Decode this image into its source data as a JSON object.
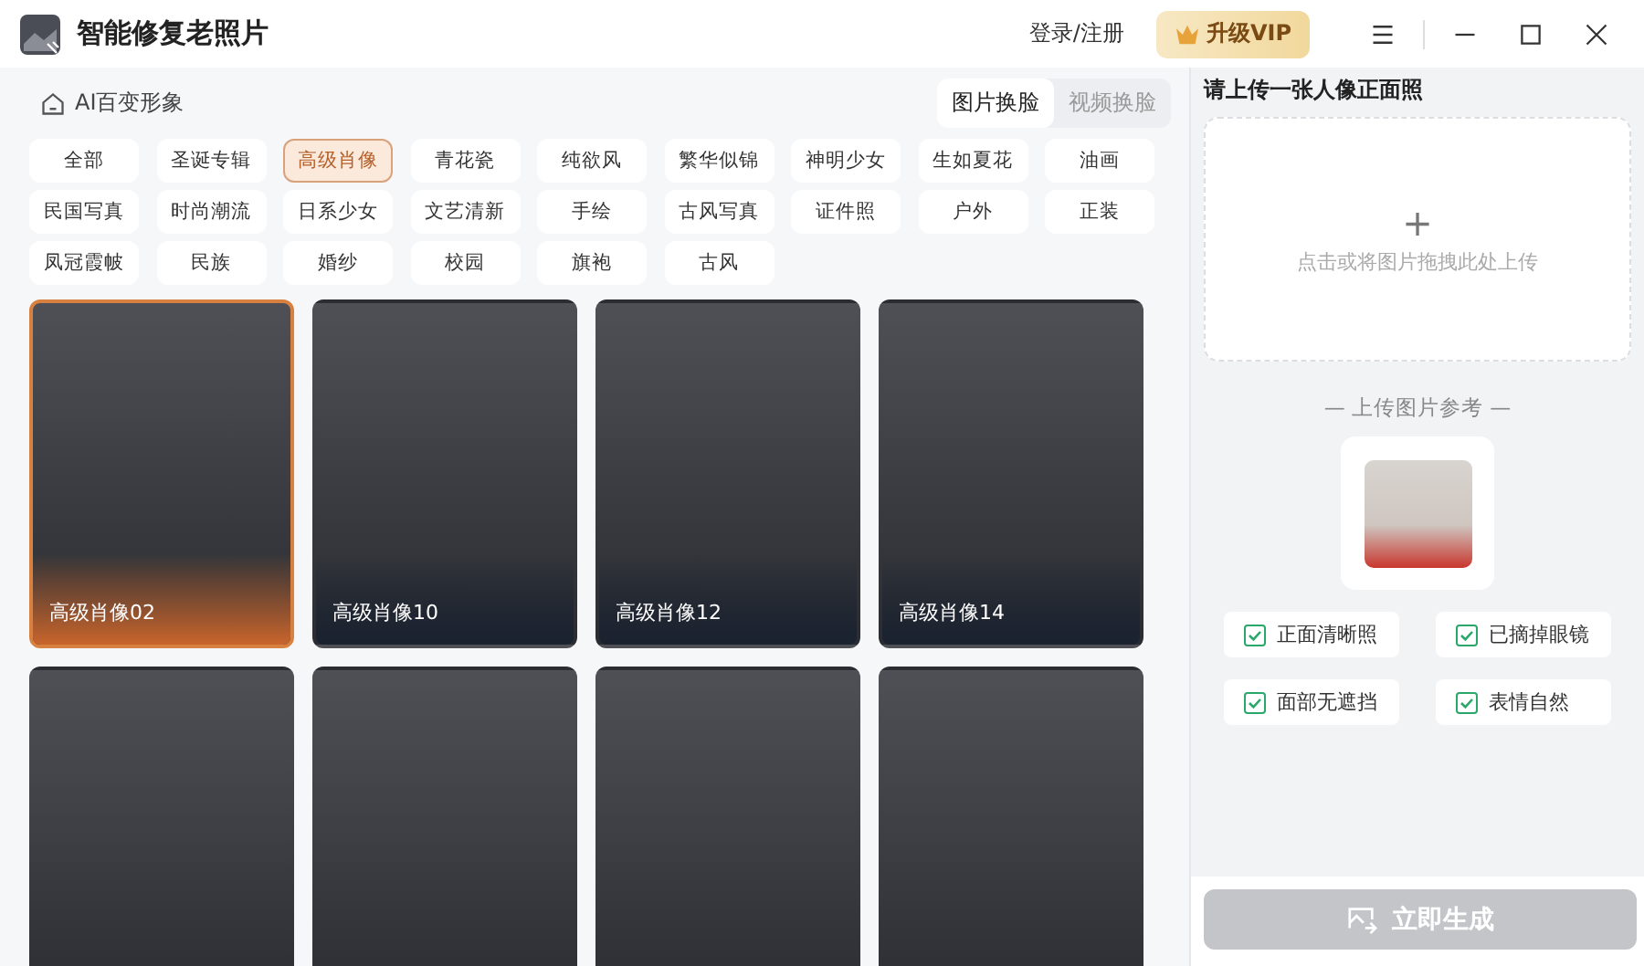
{
  "window": {
    "title": "智能修复老照片",
    "login": "登录/注册",
    "vip": "升级VIP"
  },
  "section": {
    "title": "AI百变形象"
  },
  "modes": [
    {
      "label": "图片换脸",
      "selected": true
    },
    {
      "label": "视频换脸",
      "selected": false
    }
  ],
  "tags": [
    {
      "label": "全部",
      "selected": false
    },
    {
      "label": "圣诞专辑",
      "selected": false
    },
    {
      "label": "高级肖像",
      "selected": true
    },
    {
      "label": "青花瓷",
      "selected": false
    },
    {
      "label": "纯欲风",
      "selected": false
    },
    {
      "label": "繁华似锦",
      "selected": false
    },
    {
      "label": "神明少女",
      "selected": false
    },
    {
      "label": "生如夏花",
      "selected": false
    },
    {
      "label": "油画",
      "selected": false
    },
    {
      "label": "民国写真",
      "selected": false
    },
    {
      "label": "时尚潮流",
      "selected": false
    },
    {
      "label": "日系少女",
      "selected": false
    },
    {
      "label": "文艺清新",
      "selected": false
    },
    {
      "label": "手绘",
      "selected": false
    },
    {
      "label": "古风写真",
      "selected": false
    },
    {
      "label": "证件照",
      "selected": false
    },
    {
      "label": "户外",
      "selected": false
    },
    {
      "label": "正装",
      "selected": false
    },
    {
      "label": "凤冠霞帔",
      "selected": false
    },
    {
      "label": "民族",
      "selected": false
    },
    {
      "label": "婚纱",
      "selected": false
    },
    {
      "label": "校园",
      "selected": false
    },
    {
      "label": "旗袍",
      "selected": false
    },
    {
      "label": "古风",
      "selected": false
    }
  ],
  "templates": [
    {
      "label": "高级肖像02",
      "selected": true
    },
    {
      "label": "高级肖像10",
      "selected": false
    },
    {
      "label": "高级肖像12",
      "selected": false
    },
    {
      "label": "高级肖像14",
      "selected": false
    },
    {
      "selected": false
    },
    {
      "selected": false
    },
    {
      "selected": false
    },
    {
      "selected": false
    }
  ],
  "upload": {
    "title": "请上传一张人像正面照",
    "plus": "+",
    "hint": "点击或将图片拖拽此处上传"
  },
  "reference": {
    "title": "— 上传图片参考 —"
  },
  "requirements": [
    {
      "label": "正面清晰照",
      "checked": true
    },
    {
      "label": "已摘掉眼镜",
      "checked": true
    },
    {
      "label": "面部无遮挡",
      "checked": true
    },
    {
      "label": "表情自然",
      "checked": true
    }
  ],
  "generate": {
    "label": "立即生成",
    "disabled": true
  }
}
